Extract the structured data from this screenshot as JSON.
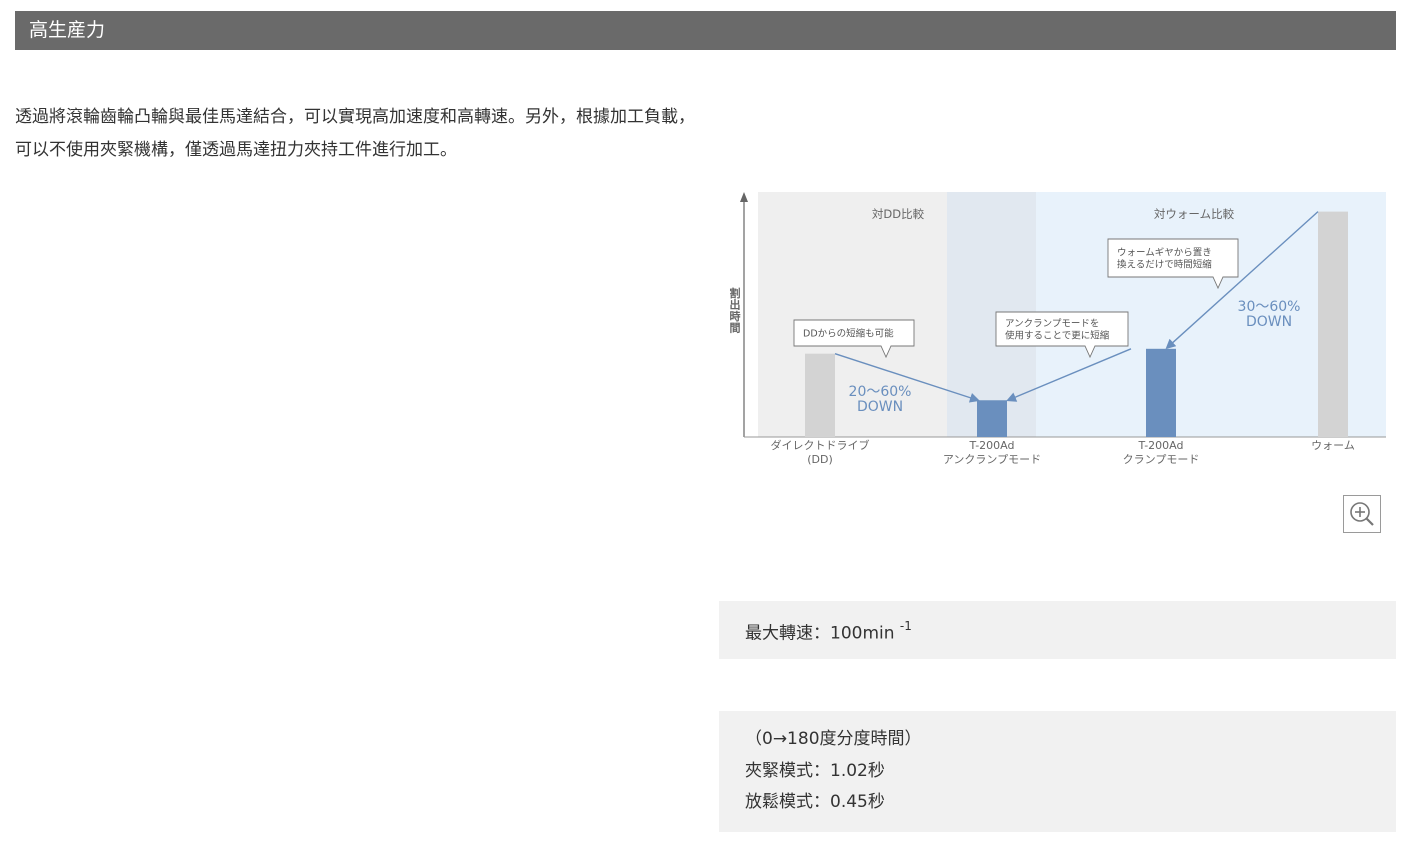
{
  "header": {
    "title": "高生産力"
  },
  "intro": {
    "text": "透過將滾輪齒輪凸輪與最佳馬達結合，可以實現高加速度和高轉速。另外，根據加工負載，可以不使用夾緊機構，僅透過馬達扭力夾持工件進行加工。"
  },
  "chart_data": {
    "type": "bar",
    "ylabel": "割出時間",
    "categories": [
      {
        "line1": "ダイレクトドライブ",
        "line2": "(DD)"
      },
      {
        "line1": "T-200Ad",
        "line2": "アンクランプモード"
      },
      {
        "line1": "T-200Ad",
        "line2": "クランプモード"
      },
      {
        "line1": "ウォーム",
        "line2": ""
      }
    ],
    "values": [
      0.34,
      0.15,
      0.36,
      0.92
    ],
    "ylim": [
      0,
      1
    ],
    "bar_colors": [
      "#d3d3d3",
      "#6a8fbe",
      "#6a8fbe",
      "#d3d3d3"
    ],
    "regions": [
      {
        "label": "対DD比較",
        "color": "#efefef"
      },
      {
        "label": "",
        "color": "#e1e8f0"
      },
      {
        "label": "対ウォーム比較",
        "color": "#e8f2fb"
      }
    ],
    "callouts": [
      {
        "lines": [
          "DDからの短縮も可能"
        ]
      },
      {
        "lines": [
          "アンクランプモードを",
          "使用することで更に短縮"
        ]
      },
      {
        "lines": [
          "ウォームギヤから置き",
          "換えるだけで時間短縮"
        ]
      }
    ],
    "reductions": [
      {
        "line1": "20～60%",
        "line2": "DOWN"
      },
      {
        "line1": "30～60%",
        "line2": "DOWN"
      }
    ],
    "accent_color": "#6a8fbe"
  },
  "zoom": {
    "icon": "zoom-in-icon"
  },
  "specs": {
    "max_speed_label": "最大轉速：100min",
    "max_speed_sup": "-1",
    "index_time_title": "（0→180度分度時間）",
    "clamp_mode": "夾緊模式：1.02秒",
    "unclamp_mode": "放鬆模式：0.45秒"
  }
}
